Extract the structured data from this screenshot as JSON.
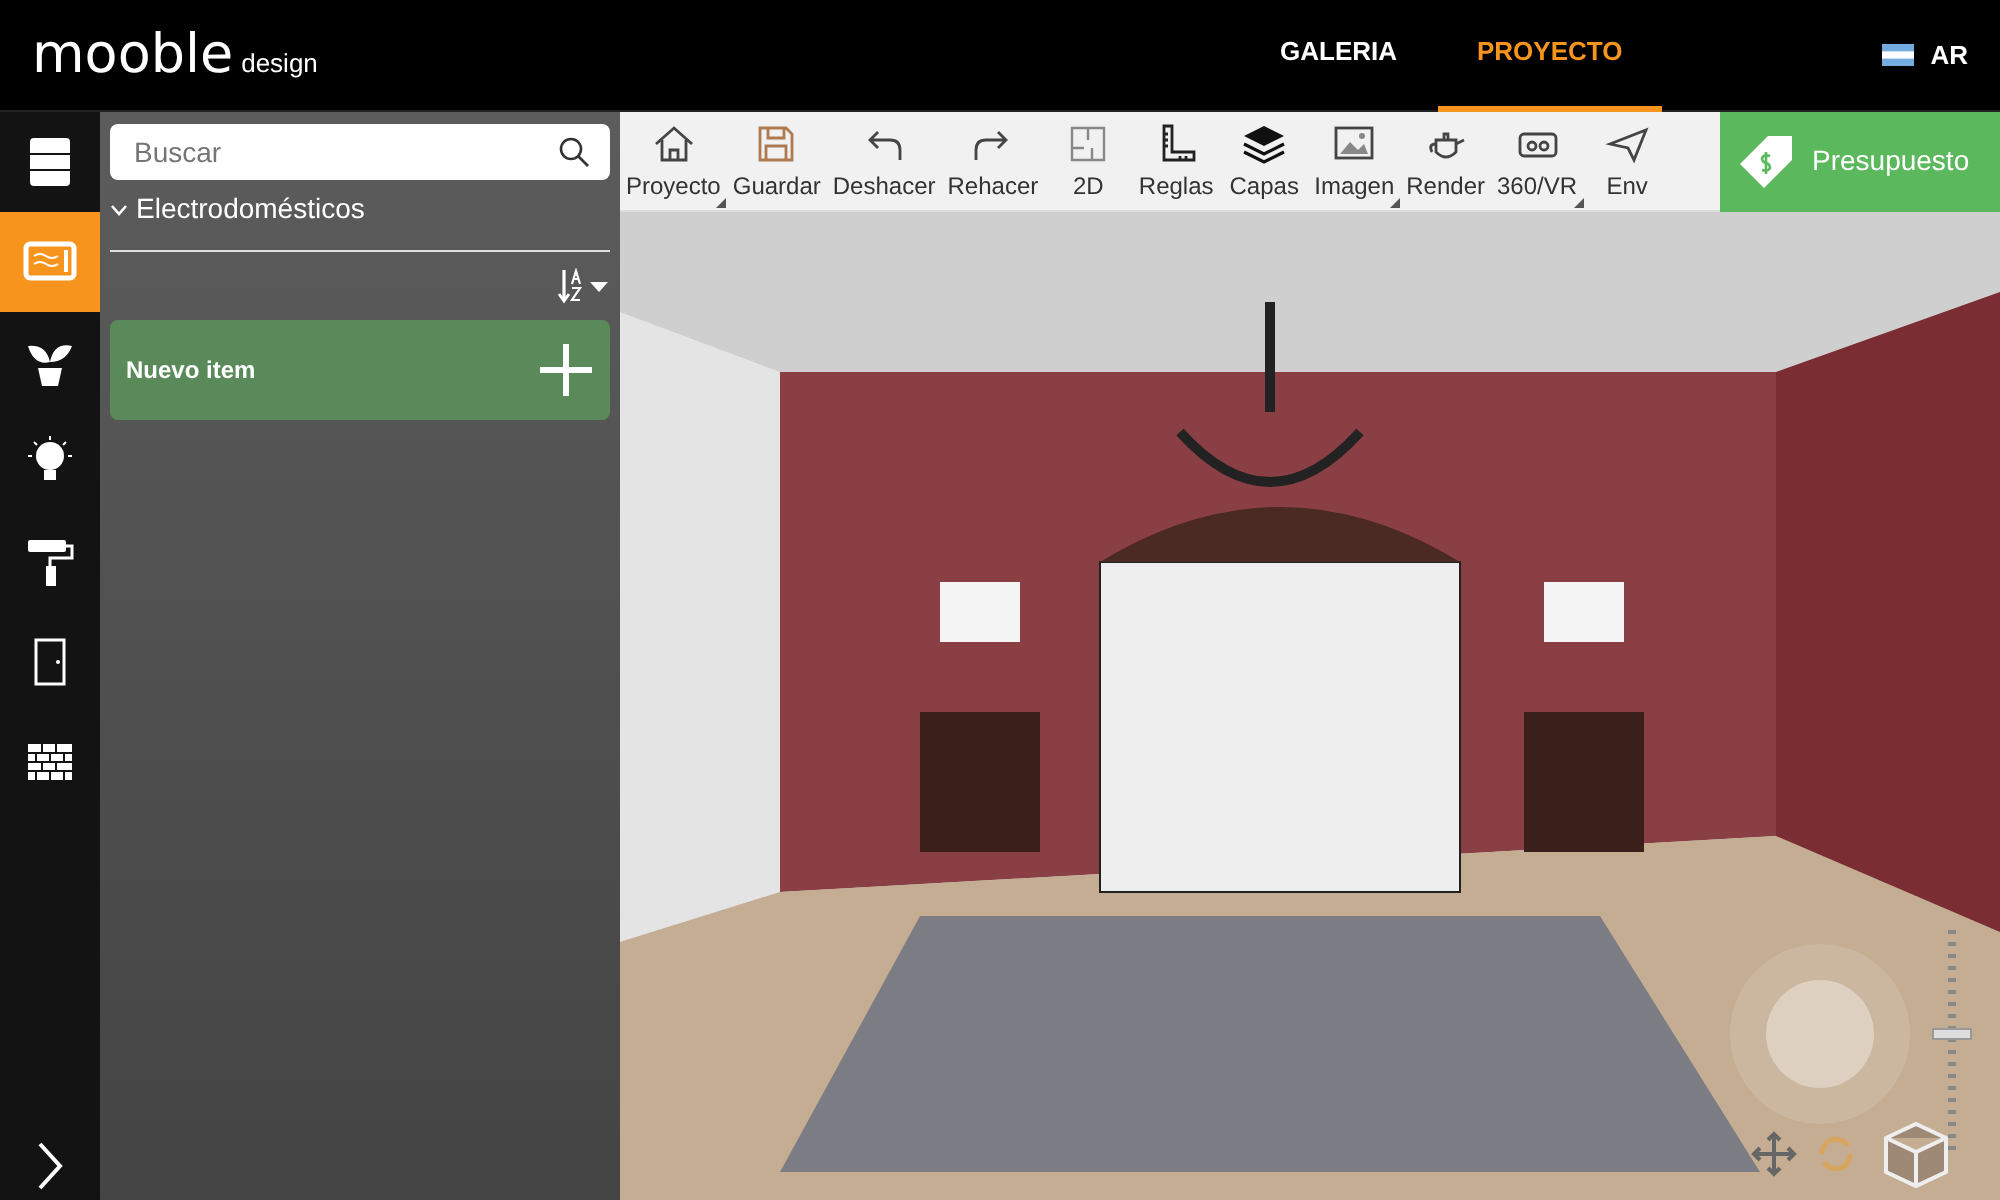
{
  "header": {
    "logo": "mooble",
    "logo_sub": "design",
    "nav": [
      {
        "label": "GALERIA",
        "selected": false
      },
      {
        "label": "PROYECTO",
        "selected": true
      }
    ],
    "country": "AR"
  },
  "sidebar": {
    "items": [
      {
        "selected": false
      },
      {
        "selected": true
      },
      {
        "selected": false
      },
      {
        "selected": false
      },
      {
        "selected": false
      },
      {
        "selected": false
      },
      {
        "selected": false
      }
    ]
  },
  "panel": {
    "search": {
      "placeholder": "Buscar"
    },
    "category": "Electrodomésticos",
    "new_item": "Nuevo item"
  },
  "toolbar": {
    "items": [
      {
        "label": "Proyecto",
        "dropdown": true
      },
      {
        "label": "Guardar",
        "dropdown": false
      },
      {
        "label": "Deshacer",
        "dropdown": false
      },
      {
        "label": "Rehacer",
        "dropdown": false
      },
      {
        "label": "2D",
        "dropdown": false
      },
      {
        "label": "Reglas",
        "dropdown": false
      },
      {
        "label": "Capas",
        "dropdown": false
      },
      {
        "label": "Imagen",
        "dropdown": true
      },
      {
        "label": "Render",
        "dropdown": false
      },
      {
        "label": "360/VR",
        "dropdown": true
      },
      {
        "label": "Env",
        "dropdown": false
      }
    ],
    "budget": "Presupuesto"
  },
  "viewport": {
    "zoom": {
      "level": 0.5
    }
  }
}
